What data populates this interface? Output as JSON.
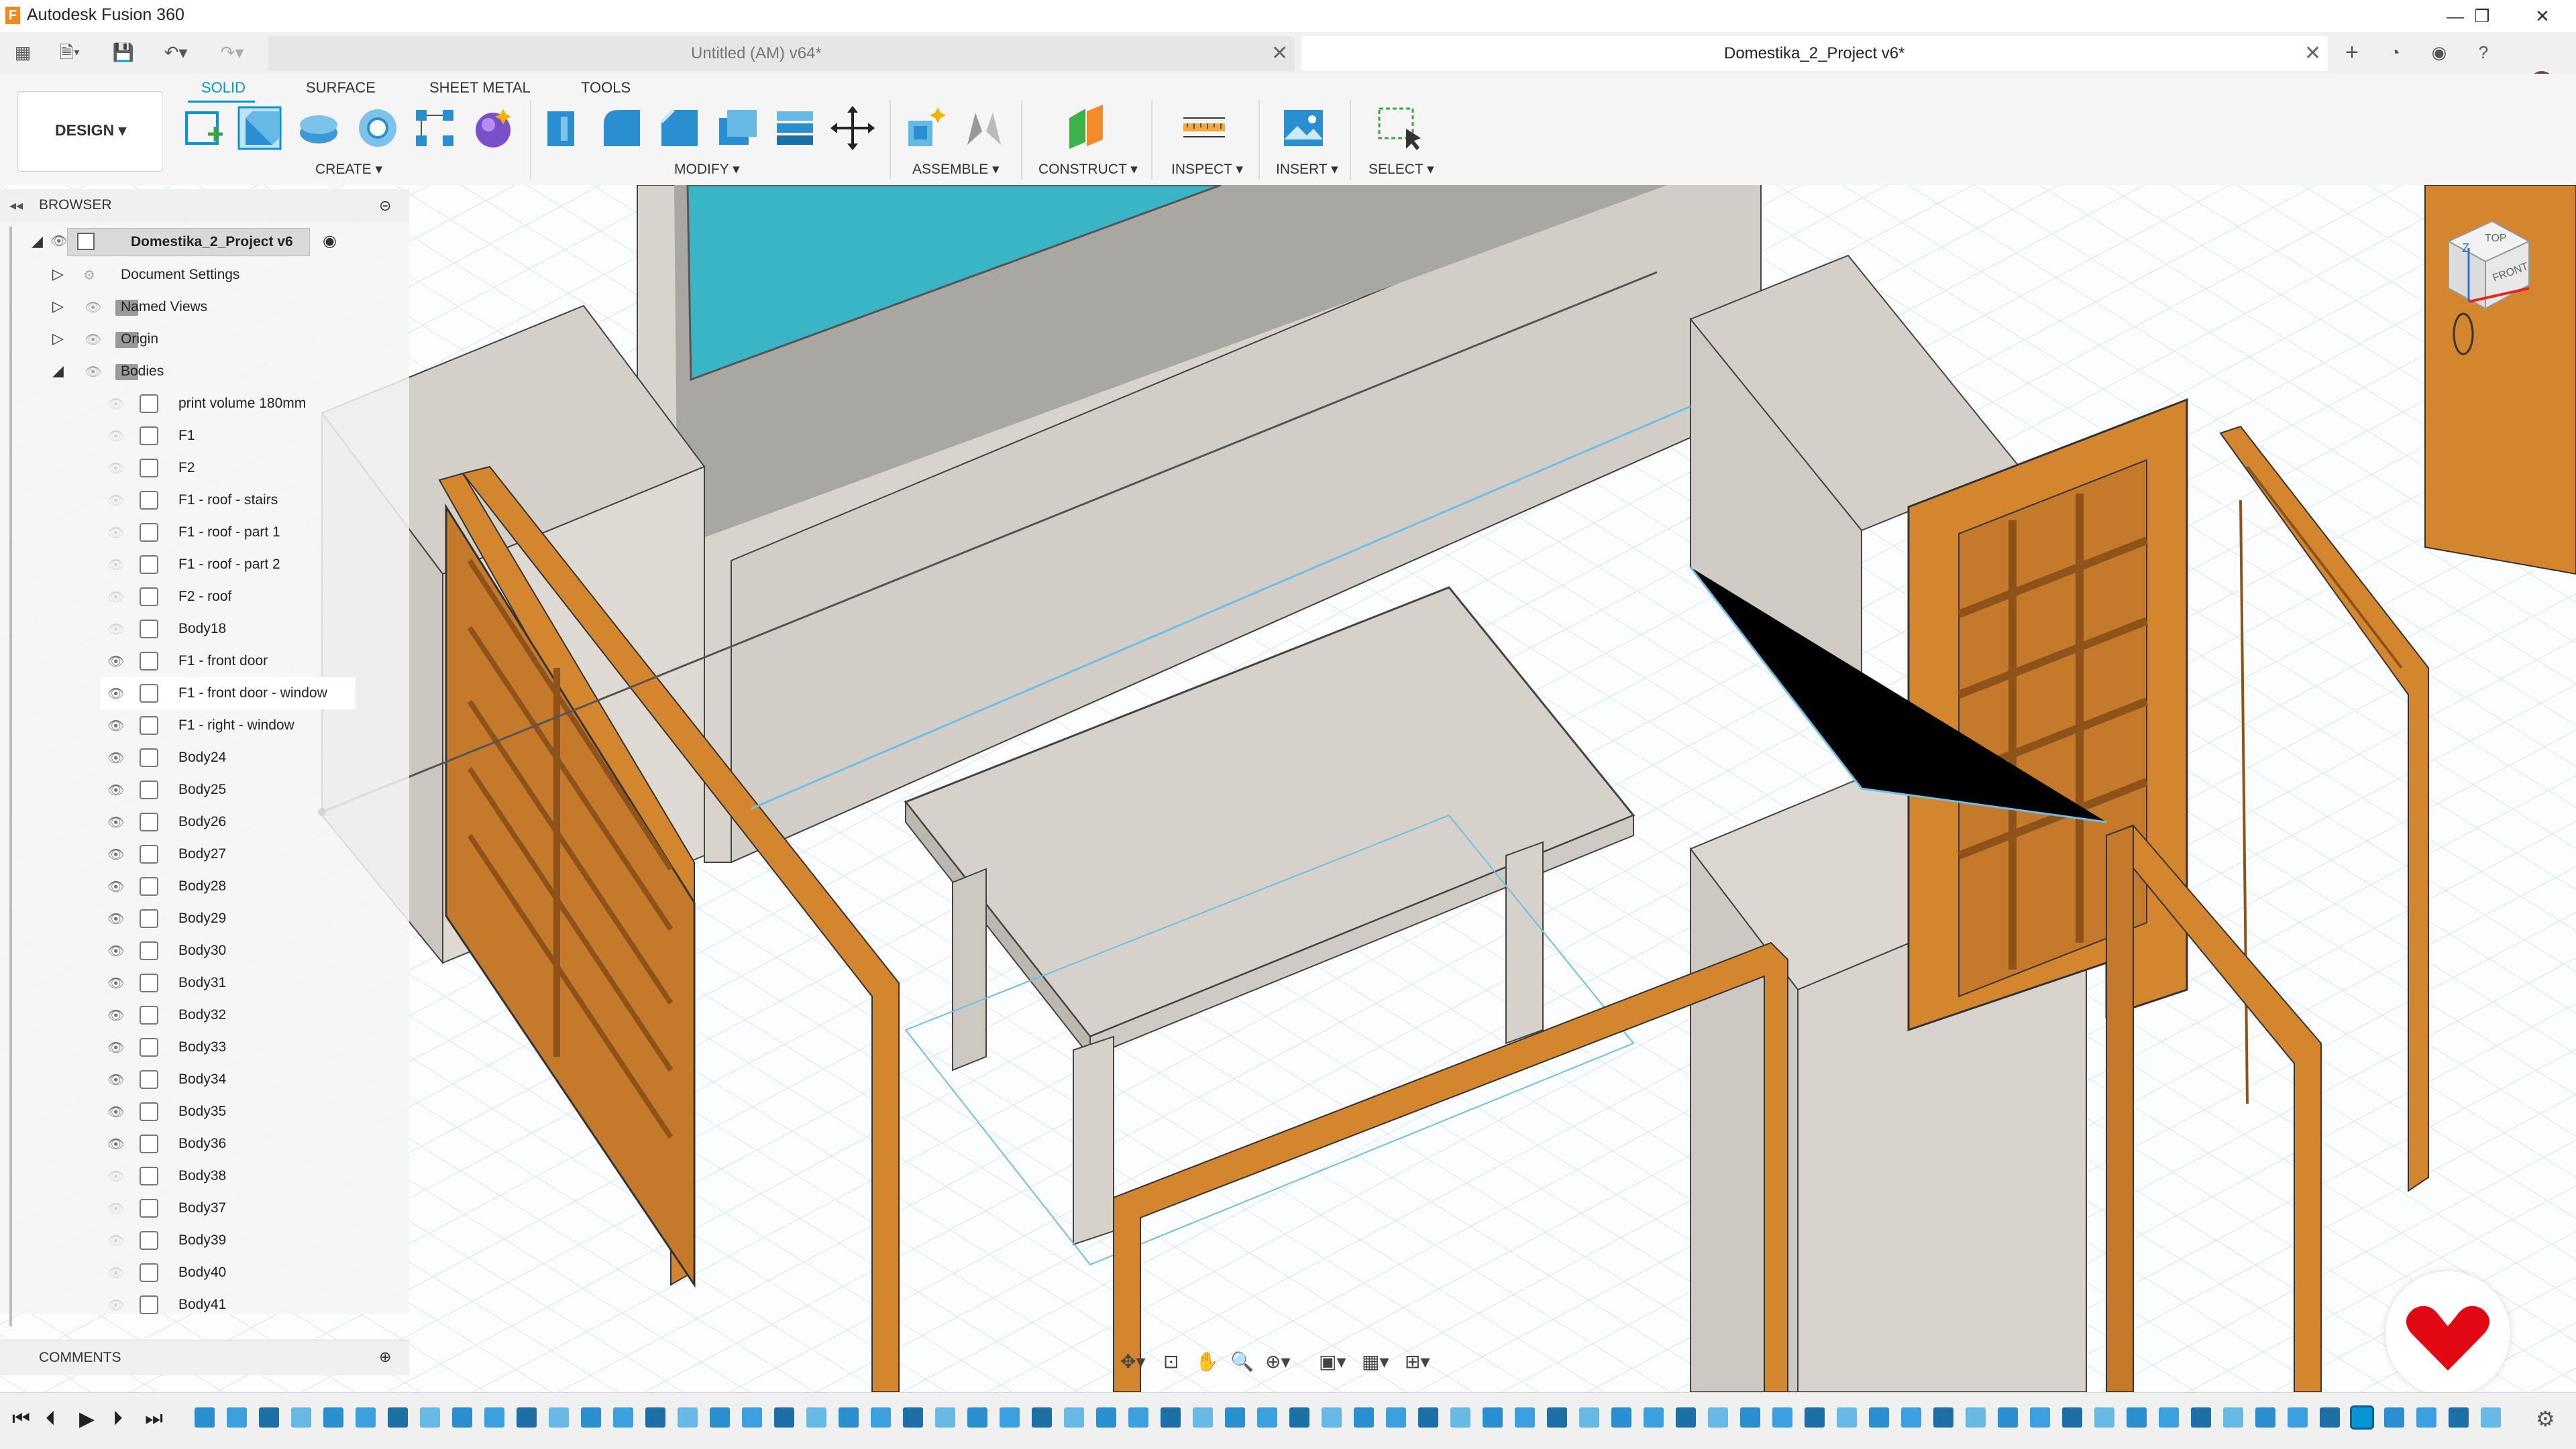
{
  "app": {
    "title": "Autodesk Fusion 360",
    "logo": "F"
  },
  "window_controls": {
    "minimize": "—",
    "maximize": "❐",
    "close": "✕"
  },
  "tabs": [
    {
      "label": "Untitled (AM) v64*",
      "close": "✕",
      "active": false
    },
    {
      "label": "Domestika_2_Project v6*",
      "close": "✕",
      "active": true
    }
  ],
  "tabbar_right": {
    "new_tab": "+"
  },
  "ribbon": {
    "tabs": [
      "SOLID",
      "SURFACE",
      "SHEET METAL",
      "TOOLS"
    ],
    "workspace": "DESIGN ▾",
    "groups": {
      "create": "CREATE ▾",
      "modify": "MODIFY ▾",
      "assemble": "ASSEMBLE ▾",
      "construct": "CONSTRUCT ▾",
      "inspect": "INSPECT ▾",
      "insert": "INSERT ▾",
      "select": "SELECT ▾"
    }
  },
  "browser": {
    "title": "BROWSER",
    "collapse": "◂◂",
    "root": "Domestika_2_Project v6",
    "nodes": [
      "Document Settings",
      "Named Views",
      "Origin",
      "Bodies"
    ],
    "bodies": [
      {
        "label": "print volume 180mm",
        "visible": false
      },
      {
        "label": "F1",
        "visible": false
      },
      {
        "label": "F2",
        "visible": false
      },
      {
        "label": "F1 - roof - stairs",
        "visible": false
      },
      {
        "label": "F1 - roof - part 1",
        "visible": false
      },
      {
        "label": "F1 - roof - part 2",
        "visible": false
      },
      {
        "label": "F2 - roof",
        "visible": false
      },
      {
        "label": "Body18",
        "visible": false
      },
      {
        "label": "F1 - front door",
        "visible": true
      },
      {
        "label": "F1 - front door - window",
        "visible": true
      },
      {
        "label": "F1 - right - window",
        "visible": true
      },
      {
        "label": "Body24",
        "visible": true
      },
      {
        "label": "Body25",
        "visible": true
      },
      {
        "label": "Body26",
        "visible": true
      },
      {
        "label": "Body27",
        "visible": true
      },
      {
        "label": "Body28",
        "visible": true
      },
      {
        "label": "Body29",
        "visible": true
      },
      {
        "label": "Body30",
        "visible": true
      },
      {
        "label": "Body31",
        "visible": true
      },
      {
        "label": "Body32",
        "visible": true
      },
      {
        "label": "Body33",
        "visible": true
      },
      {
        "label": "Body34",
        "visible": true
      },
      {
        "label": "Body35",
        "visible": true
      },
      {
        "label": "Body36",
        "visible": true
      },
      {
        "label": "Body38",
        "visible": false
      },
      {
        "label": "Body37",
        "visible": false
      },
      {
        "label": "Body39",
        "visible": false
      },
      {
        "label": "Body40",
        "visible": false
      },
      {
        "label": "Body41",
        "visible": false
      }
    ]
  },
  "comments": {
    "title": "COMMENTS"
  },
  "viewcube": {
    "top": "TOP",
    "front": "FRONT",
    "axis_z": "Z",
    "axis_x": "X"
  },
  "timeline": {
    "controls": [
      "⏮",
      "⏴",
      "▶",
      "⏵",
      "⏭"
    ]
  },
  "colors": {
    "accent": "#0696d7",
    "wood": "#d4862e",
    "wall": "#d8d4cc",
    "glass": "#3ab5c6"
  }
}
